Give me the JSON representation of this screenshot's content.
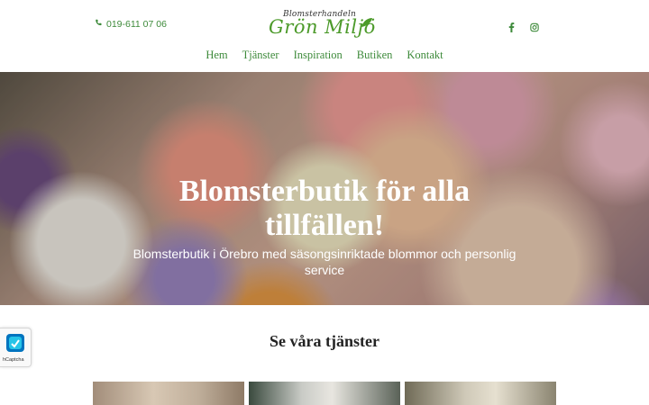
{
  "header": {
    "phone": "019-611 07 06",
    "logo": {
      "top_text": "Blomsterhandeln",
      "main_text": "Grön Miljö"
    },
    "social": [
      {
        "icon": "facebook-icon"
      },
      {
        "icon": "instagram-icon"
      }
    ]
  },
  "nav": {
    "items": [
      {
        "label": "Hem"
      },
      {
        "label": "Tjänster"
      },
      {
        "label": "Inspiration"
      },
      {
        "label": "Butiken"
      },
      {
        "label": "Kontakt"
      }
    ]
  },
  "hero": {
    "title": "Blomsterbutik för alla tillfällen!",
    "subtitle": "Blomsterbutik i Örebro med säsongsinriktade blommor och personlig service"
  },
  "captcha": {
    "label": "hCaptcha"
  },
  "services": {
    "title": "Se våra tjänster"
  },
  "colors": {
    "accent_green": "#3d8a3a",
    "logo_green": "#4c9a2a",
    "text_dark": "#222222"
  }
}
